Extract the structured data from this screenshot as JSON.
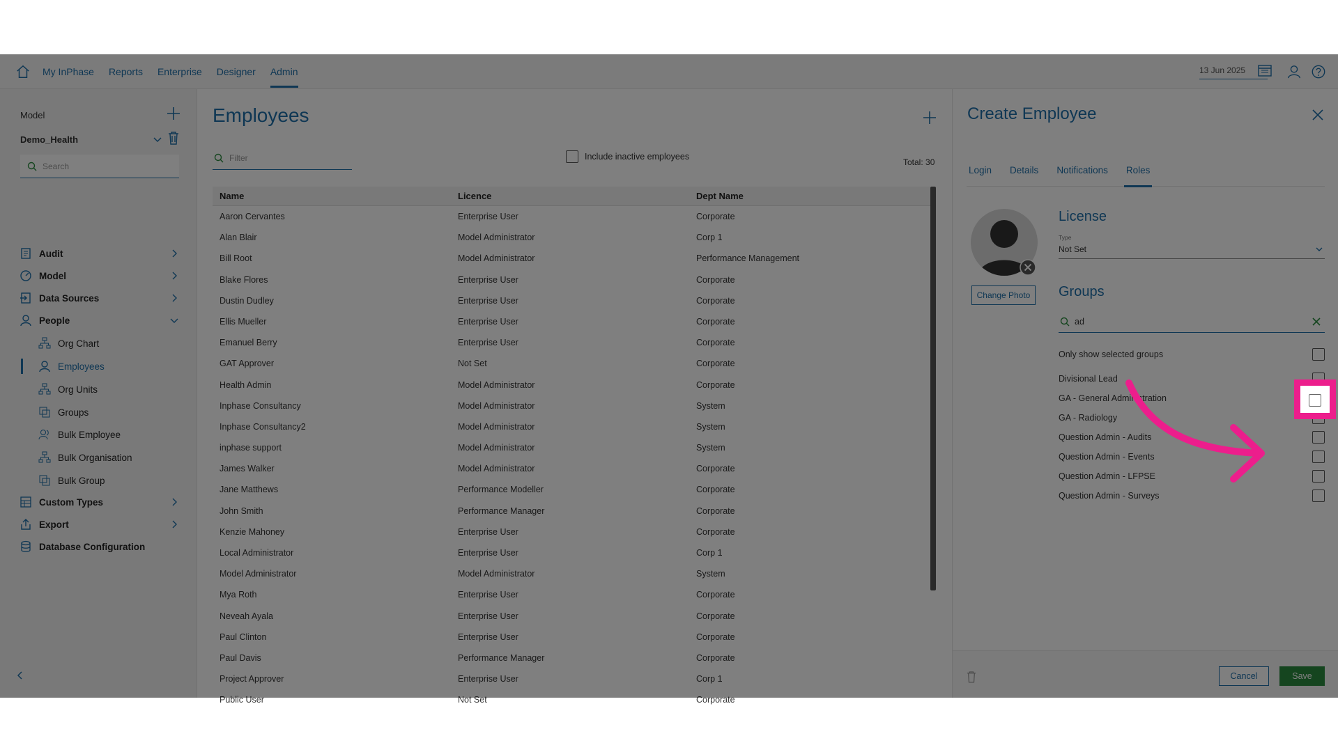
{
  "nav": {
    "items": [
      {
        "label": "My InPhase",
        "active": false
      },
      {
        "label": "Reports",
        "active": false
      },
      {
        "label": "Enterprise",
        "active": false
      },
      {
        "label": "Designer",
        "active": false
      },
      {
        "label": "Admin",
        "active": true
      }
    ],
    "date": "13 Jun 2025"
  },
  "sidebar": {
    "section_label": "Model",
    "model_name": "Demo_Health",
    "search_placeholder": "Search",
    "items": [
      {
        "label": "Audit",
        "icon": "audit-icon",
        "level": 1,
        "expanded": false
      },
      {
        "label": "Model",
        "icon": "model-icon",
        "level": 1,
        "expanded": false
      },
      {
        "label": "Data Sources",
        "icon": "data-sources-icon",
        "level": 1,
        "expanded": false
      },
      {
        "label": "People",
        "icon": "people-icon",
        "level": 1,
        "expanded": true
      },
      {
        "label": "Org Chart",
        "icon": "org-chart-icon",
        "level": 2
      },
      {
        "label": "Employees",
        "icon": "employee-icon",
        "level": 2,
        "active": true
      },
      {
        "label": "Org Units",
        "icon": "org-units-icon",
        "level": 2
      },
      {
        "label": "Groups",
        "icon": "groups-icon",
        "level": 2
      },
      {
        "label": "Bulk Employee",
        "icon": "bulk-employee-icon",
        "level": 2
      },
      {
        "label": "Bulk Organisation",
        "icon": "bulk-organisation-icon",
        "level": 2
      },
      {
        "label": "Bulk Group",
        "icon": "bulk-group-icon",
        "level": 2
      },
      {
        "label": "Custom Types",
        "icon": "custom-types-icon",
        "level": 1,
        "expanded": false
      },
      {
        "label": "Export",
        "icon": "export-icon",
        "level": 1,
        "expanded": false
      },
      {
        "label": "Database Configuration",
        "icon": "database-icon",
        "level": 1
      }
    ]
  },
  "main": {
    "title": "Employees",
    "filter_placeholder": "Filter",
    "include_inactive_label": "Include inactive employees",
    "total": "Total: 30",
    "columns": [
      "Name",
      "Licence",
      "Dept Name"
    ],
    "rows": [
      [
        "Aaron Cervantes",
        "Enterprise User",
        "Corporate"
      ],
      [
        "Alan Blair",
        "Model Administrator",
        "Corp 1"
      ],
      [
        "Bill Root",
        "Model Administrator",
        "Performance Management"
      ],
      [
        "Blake Flores",
        "Enterprise User",
        "Corporate"
      ],
      [
        "Dustin Dudley",
        "Enterprise User",
        "Corporate"
      ],
      [
        "Ellis Mueller",
        "Enterprise User",
        "Corporate"
      ],
      [
        "Emanuel Berry",
        "Enterprise User",
        "Corporate"
      ],
      [
        "GAT Approver",
        "Not Set",
        "Corporate"
      ],
      [
        "Health Admin",
        "Model Administrator",
        "Corporate"
      ],
      [
        "Inphase Consultancy",
        "Model Administrator",
        "System"
      ],
      [
        "Inphase Consultancy2",
        "Model Administrator",
        "System"
      ],
      [
        "inphase support",
        "Model Administrator",
        "System"
      ],
      [
        "James Walker",
        "Model Administrator",
        "Corporate"
      ],
      [
        "Jane Matthews",
        "Performance Modeller",
        "Corporate"
      ],
      [
        "John Smith",
        "Performance Manager",
        "Corporate"
      ],
      [
        "Kenzie Mahoney",
        "Enterprise User",
        "Corporate"
      ],
      [
        "Local Administrator",
        "Enterprise User",
        "Corp 1"
      ],
      [
        "Model Administrator",
        "Model Administrator",
        "System"
      ],
      [
        "Mya Roth",
        "Enterprise User",
        "Corporate"
      ],
      [
        "Neveah Ayala",
        "Enterprise User",
        "Corporate"
      ],
      [
        "Paul Clinton",
        "Enterprise User",
        "Corporate"
      ],
      [
        "Paul Davis",
        "Performance Manager",
        "Corporate"
      ],
      [
        "Project Approver",
        "Enterprise User",
        "Corp 1"
      ],
      [
        "Public User",
        "Not Set",
        "Corporate"
      ]
    ]
  },
  "panel": {
    "title": "Create Employee",
    "tabs": [
      {
        "label": "Login",
        "active": false
      },
      {
        "label": "Details",
        "active": false
      },
      {
        "label": "Notifications",
        "active": false
      },
      {
        "label": "Roles",
        "active": true
      }
    ],
    "change_photo_label": "Change Photo",
    "license_heading": "License",
    "type_label": "Type",
    "type_value": "Not Set",
    "groups_heading": "Groups",
    "group_search_value": "ad",
    "only_selected_label": "Only show selected groups",
    "groups": [
      {
        "label": "Divisional Lead",
        "checked": false
      },
      {
        "label": "GA - General Administration",
        "checked": false
      },
      {
        "label": "GA - Radiology",
        "checked": false
      },
      {
        "label": "Question Admin - Audits",
        "checked": false
      },
      {
        "label": "Question Admin - Events",
        "checked": false
      },
      {
        "label": "Question Admin - LFPSE",
        "checked": false
      },
      {
        "label": "Question Admin - Surveys",
        "checked": false
      }
    ],
    "cancel_label": "Cancel",
    "save_label": "Save"
  },
  "colors": {
    "accent": "#1f6fa8",
    "save": "#2b8a3e",
    "highlight": "#ec1e8c"
  }
}
